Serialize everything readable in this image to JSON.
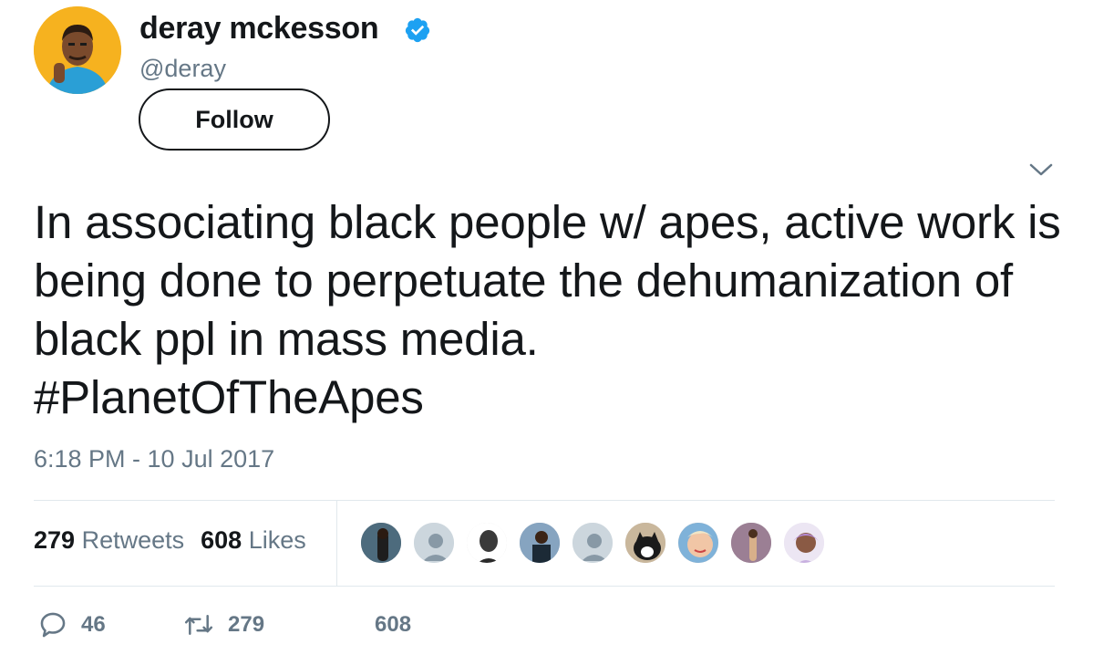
{
  "user": {
    "display_name": "deray mckesson",
    "handle": "@deray",
    "follow_label": "Follow"
  },
  "tweet": {
    "text": "In associating black people w/ apes, active work is being done to perpetuate the dehumanization of black ppl in mass media.",
    "hashtag": "#PlanetOfTheApes",
    "timestamp": "6:18 PM - 10 Jul 2017"
  },
  "stats": {
    "retweets_count": "279",
    "retweets_label": "Retweets",
    "likes_count": "608",
    "likes_label": "Likes"
  },
  "actions": {
    "reply_count": "46",
    "retweet_count": "279",
    "like_count": "608"
  },
  "colors": {
    "text": "#14171a",
    "muted": "#657786",
    "verified": "#1da1f2",
    "divider": "#e1e8ed",
    "avatar_bg": "#f6b21f"
  },
  "icons": [
    "verified-badge-icon",
    "caret-down-icon",
    "reply-icon",
    "retweet-icon",
    "like-icon"
  ]
}
